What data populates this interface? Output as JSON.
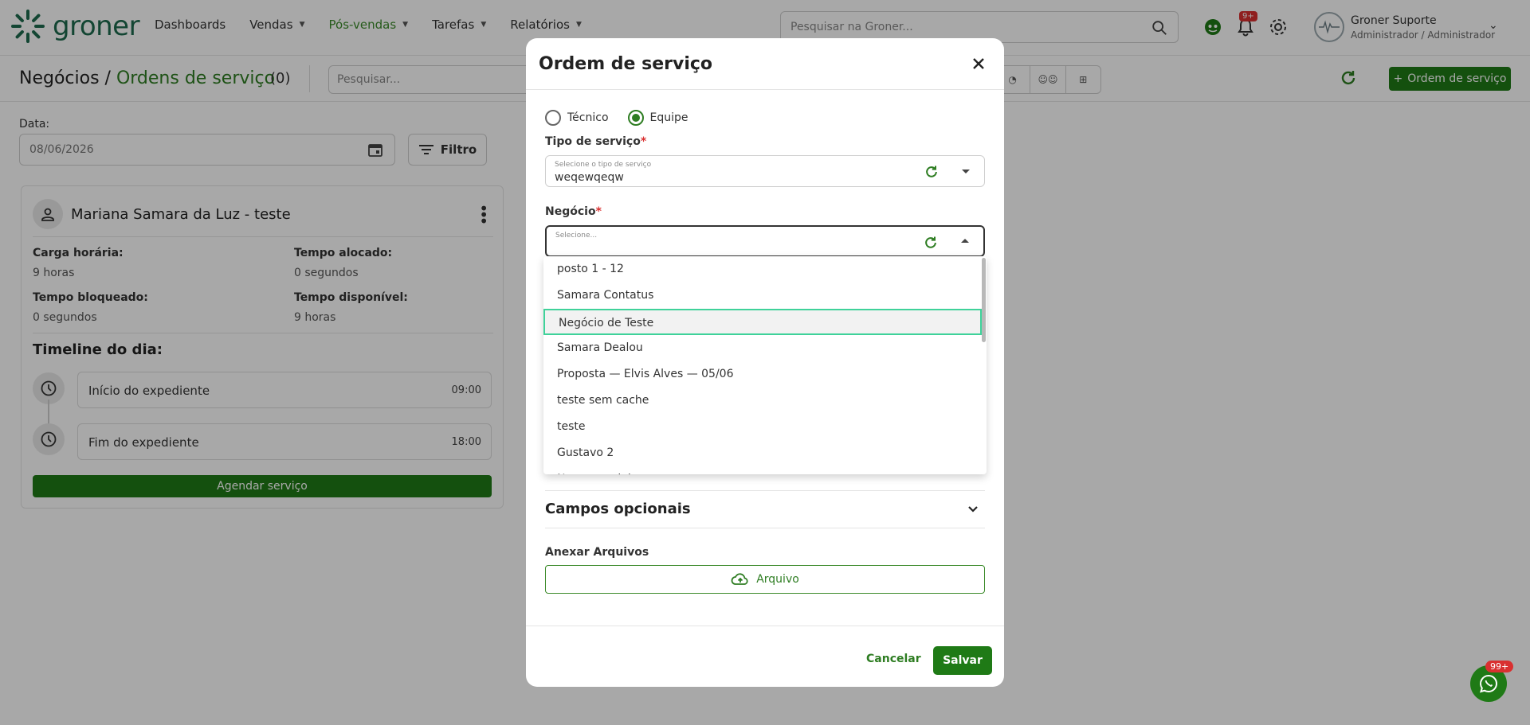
{
  "app": {
    "logo_text": "groner",
    "brand_color": "#2e7d22",
    "nav": [
      {
        "label": "Dashboards",
        "has_caret": false
      },
      {
        "label": "Vendas",
        "has_caret": true
      },
      {
        "label": "Pós-vendas",
        "has_caret": true,
        "active": true
      },
      {
        "label": "Tarefas",
        "has_caret": true
      },
      {
        "label": "Relatórios",
        "has_caret": true
      }
    ],
    "search_placeholder": "Pesquisar na Groner...",
    "notifications_badge": "9+",
    "user_name": "Groner Suporte",
    "user_role": "Administrador / Administrador"
  },
  "subheader": {
    "crumb_root": "Negócios /",
    "crumb_current": "Ordens de serviço",
    "count": "(0)",
    "search_placeholder": "Pesquisar...",
    "new_button": "Ordem de serviço"
  },
  "filters": {
    "date_label": "Data:",
    "date_value": "08/06/2026",
    "filter_button": "Filtro"
  },
  "card": {
    "name": "Mariana Samara da Luz - teste",
    "stats": [
      {
        "key": "Carga horária:",
        "value": "9 horas"
      },
      {
        "key": "Tempo alocado:",
        "value": "0 segundos"
      },
      {
        "key": "Tempo bloqueado:",
        "value": "0 segundos"
      },
      {
        "key": "Tempo disponível:",
        "value": "9 horas"
      }
    ],
    "timeline_title": "Timeline do dia:",
    "timeline": [
      {
        "label": "Início do expediente",
        "time": "09:00"
      },
      {
        "label": "Fim do expediente",
        "time": "18:00"
      }
    ],
    "schedule_button": "Agendar serviço"
  },
  "modal": {
    "title": "Ordem de serviço",
    "radio_tecnico": "Técnico",
    "radio_equipe": "Equipe",
    "radio_selected": "Equipe",
    "tipo_label": "Tipo de serviço",
    "tipo_placeholder": "Selecione o tipo de serviço",
    "tipo_value": "weqewqeqw",
    "negocio_label": "Negócio",
    "negocio_placeholder": "Selecione...",
    "required_mark": "*",
    "options": [
      "posto 1 - 12",
      "Samara Contatus",
      "Negócio de Teste",
      "Samara Dealou",
      "Proposta — Elvis Alves — 05/06",
      "teste sem cache",
      "teste",
      "Gustavo 2",
      "Nome parcial"
    ],
    "highlighted_option": "Negócio de Teste",
    "optional_fields": "Campos opcionais",
    "attach_label": "Anexar Arquivos",
    "file_button": "Arquivo",
    "cancel": "Cancelar",
    "save": "Salvar"
  },
  "fab_badge": "99+"
}
